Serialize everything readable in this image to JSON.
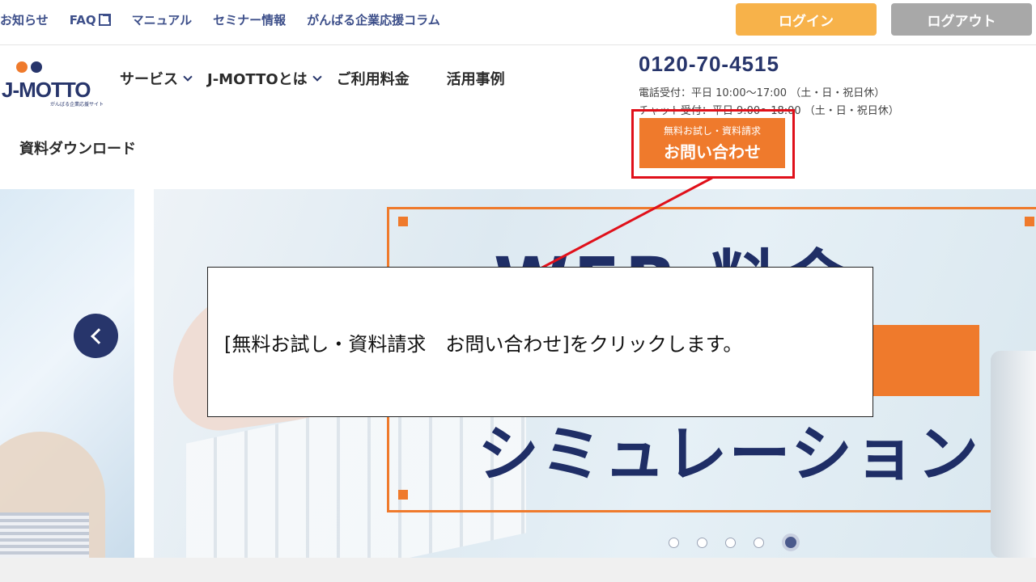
{
  "top_links": [
    {
      "label": "お知らせ"
    },
    {
      "label": "FAQ"
    },
    {
      "label": "マニュアル"
    },
    {
      "label": "セミナー情報"
    },
    {
      "label": "がんばる企業応援コラム"
    }
  ],
  "auth": {
    "login": "ログイン",
    "logout": "ログアウト"
  },
  "logo": {
    "text": "J-MOTTO",
    "sub": "がんばる企業応援サイト"
  },
  "nav": {
    "service": "サービス",
    "about": "J-MOTTOとは",
    "pricing": "ご利用料金",
    "cases": "活用事例",
    "download": "資料ダウンロード"
  },
  "contact": {
    "phone": "0120-70-4515",
    "hours_phone": "電話受付：平日 10:00～17:00 （土・日・祝日休）",
    "hours_chat": "チャット受付：平日 9:00～18:00 （土・日・祝日休）"
  },
  "cta": {
    "sub": "無料お試し・資料請求",
    "main": "お問い合わせ"
  },
  "hero": {
    "headline": "WEB 料金",
    "subline": "シミュレーション"
  },
  "carousel": {
    "slide_count": 5,
    "active_slide": 5
  },
  "annotation": {
    "text": "[無料お試し・資料請求　お問い合わせ]をクリックします。"
  },
  "colors": {
    "accent": "#ef7a2c",
    "brand": "#27356b",
    "highlight": "#e0101a"
  }
}
